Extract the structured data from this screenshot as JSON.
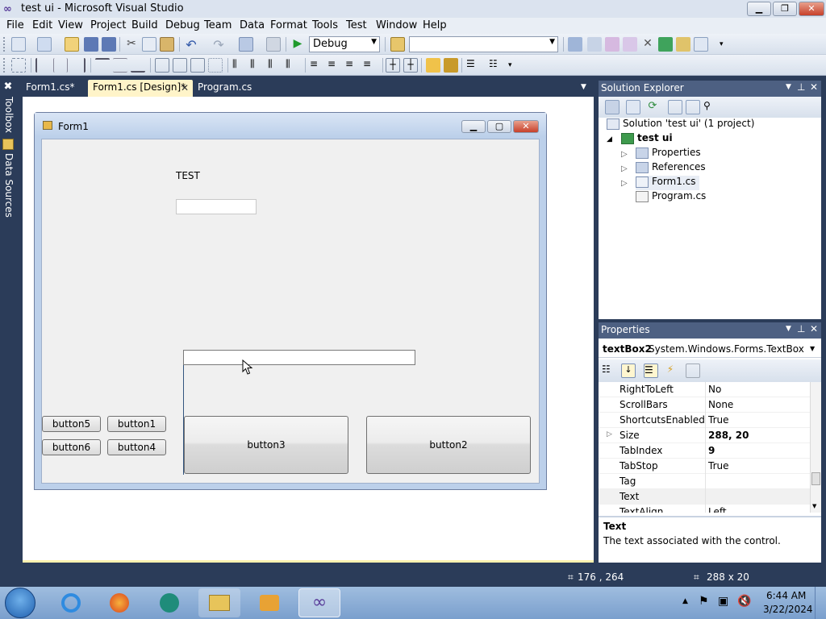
{
  "window": {
    "title": "test ui - Microsoft Visual Studio",
    "buttons": [
      "minimize",
      "maximize",
      "close"
    ]
  },
  "menu": [
    "File",
    "Edit",
    "View",
    "Project",
    "Build",
    "Debug",
    "Team",
    "Data",
    "Format",
    "Tools",
    "Test",
    "Window",
    "Help"
  ],
  "toolbar": {
    "config_combo": "Debug",
    "platform_combo": ""
  },
  "left_tabs": [
    "Toolbox",
    "Data Sources"
  ],
  "doc_tabs": [
    {
      "label": "Form1.cs*",
      "active": false
    },
    {
      "label": "Form1.cs [Design]*",
      "active": true
    },
    {
      "label": "Program.cs",
      "active": false
    }
  ],
  "form": {
    "title": "Form1",
    "label": "TEST",
    "buttons": [
      "button5",
      "button1",
      "button6",
      "button4",
      "button3",
      "button2"
    ]
  },
  "solution_explorer": {
    "title": "Solution Explorer",
    "items": [
      {
        "label": "Solution 'test ui' (1 project)",
        "icon": "solution-icon",
        "bold": false
      },
      {
        "label": "test ui",
        "icon": "csharp-project-icon",
        "bold": true
      },
      {
        "label": "Properties",
        "icon": "folder-icon",
        "bold": false
      },
      {
        "label": "References",
        "icon": "folder-icon",
        "bold": false
      },
      {
        "label": "Form1.cs",
        "icon": "form-file-icon",
        "bold": false
      },
      {
        "label": "Program.cs",
        "icon": "cs-file-icon",
        "bold": false
      }
    ]
  },
  "properties": {
    "title": "Properties",
    "object_name": "textBox2",
    "object_type": "System.Windows.Forms.TextBox",
    "rows": [
      {
        "name": "RightToLeft",
        "value": "No",
        "bold": false
      },
      {
        "name": "ScrollBars",
        "value": "None",
        "bold": false
      },
      {
        "name": "ShortcutsEnabled",
        "value": "True",
        "bold": false
      },
      {
        "name": "Size",
        "value": "288, 20",
        "bold": true
      },
      {
        "name": "TabIndex",
        "value": "9",
        "bold": true
      },
      {
        "name": "TabStop",
        "value": "True",
        "bold": false
      },
      {
        "name": "Tag",
        "value": "",
        "bold": false
      },
      {
        "name": "Text",
        "value": "",
        "bold": false
      },
      {
        "name": "TextAlign",
        "value": "Left",
        "bold": false
      }
    ],
    "desc_title": "Text",
    "desc_text": "The text associated with the control."
  },
  "status": {
    "position": "176 , 264",
    "size": "288 x 20"
  },
  "taskbar": {
    "time": "6:44 AM",
    "date": "3/22/2024"
  }
}
